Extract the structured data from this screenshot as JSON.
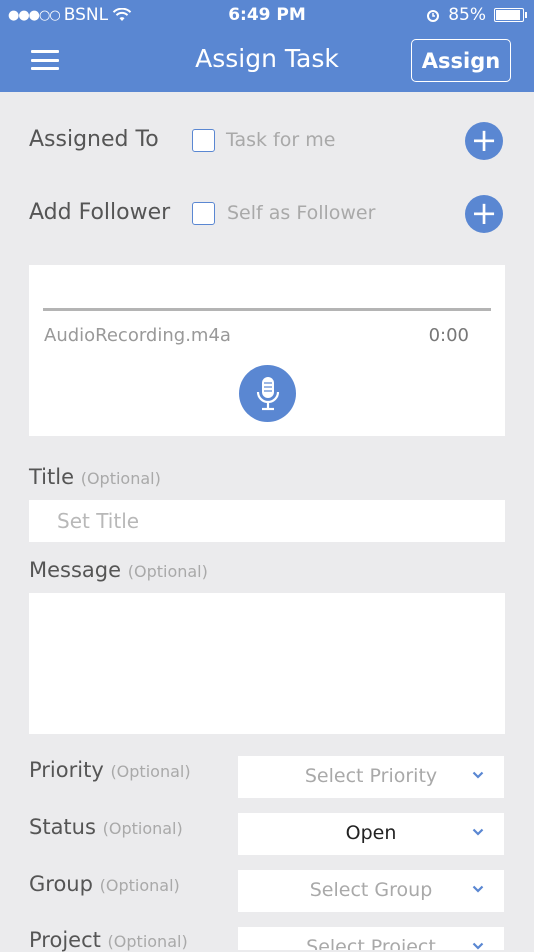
{
  "status_bar": {
    "carrier": "BSNL",
    "time": "6:49 PM",
    "battery": "85%"
  },
  "header": {
    "title": "Assign Task",
    "assign_label": "Assign"
  },
  "assigned_to": {
    "label": "Assigned To",
    "checkbox_label": "Task for me"
  },
  "add_follower": {
    "label": "Add Follower",
    "checkbox_label": "Self as Follower"
  },
  "audio": {
    "filename": "AudioRecording.m4a",
    "duration": "0:00"
  },
  "title_field": {
    "label": "Title",
    "optional": "(Optional)",
    "placeholder": "Set Title"
  },
  "message_field": {
    "label": "Message",
    "optional": "(Optional)"
  },
  "priority": {
    "label": "Priority",
    "optional": "(Optional)",
    "value": "Select Priority"
  },
  "status": {
    "label": "Status",
    "optional": "(Optional)",
    "value": "Open"
  },
  "group": {
    "label": "Group",
    "optional": "(Optional)",
    "value": "Select Group"
  },
  "project": {
    "label": "Project",
    "optional": "(Optional)",
    "value": "Select Project"
  },
  "colors": {
    "accent": "#5a87d2",
    "background": "#ebebed"
  }
}
